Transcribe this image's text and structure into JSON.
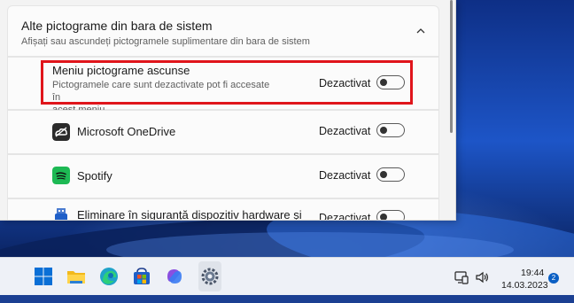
{
  "section": {
    "title": "Alte pictograme din bara de sistem",
    "subtitle": "Afișați sau ascundeți pictogramele suplimentare din bara de sistem"
  },
  "rows": [
    {
      "title": "Meniu pictograme ascunse",
      "subtitle_line1": "Pictogramele care sunt dezactivate pot fi accesate în",
      "subtitle_line2": "acest meniu",
      "state": "Dezactivat",
      "icon": null
    },
    {
      "title": "Microsoft OneDrive",
      "state": "Dezactivat",
      "icon": "onedrive-icon"
    },
    {
      "title": "Spotify",
      "state": "Dezactivat",
      "icon": "spotify-icon"
    },
    {
      "title_line1": "Eliminare în siguranță dispozitiv hardware și",
      "state": "Dezactivat",
      "icon": "usb-eject-icon"
    }
  ],
  "taskbar": {
    "apps": [
      "start-icon",
      "file-explorer-icon",
      "edge-icon",
      "microsoft-store-icon",
      "copilot-icon",
      "settings-icon"
    ],
    "tray_icons": [
      "device-icon",
      "volume-icon"
    ],
    "time": "19:44",
    "date": "14.03.2023",
    "notification_count": "2"
  },
  "colors": {
    "highlight": "#e0151b",
    "spotify": "#1db954",
    "onedrive_tile": "#2b2b2b",
    "accent": "#0a5fc4"
  }
}
